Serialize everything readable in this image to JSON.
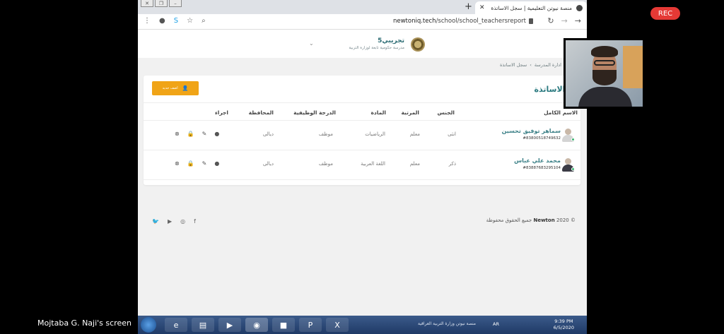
{
  "browser": {
    "tab_title": "منصة نيوتن التعليمية | سجل الاساتذة",
    "url_host": "newtoniq.tech",
    "url_path": "/school/school_teachersreport"
  },
  "site": {
    "school_name": "تجريبي5",
    "school_sub": "مدرسة حكومية تابعة لوزارة التربية"
  },
  "breadcrumb": {
    "parent": "ادارة المدرسة",
    "separator": "›",
    "current": "سجل الاساتذة"
  },
  "page": {
    "title": "جل الاساتذة",
    "add_button": "اضف جديد"
  },
  "table": {
    "headers": {
      "name": "الاسم الكامل",
      "gender": "الجنس",
      "rank": "المرتبة",
      "subject": "المادة",
      "grade": "الدرجة الوظيفية",
      "province": "المحافظة",
      "action": "اجراء"
    },
    "rows": [
      {
        "name": "سماهر توفيق تحسين",
        "id": "#8380051874963​2",
        "gender": "انثى",
        "rank": "معلم",
        "subject": "الرياضيات",
        "grade": "موظف",
        "province": "ديالى"
      },
      {
        "name": "محمد علي عباس",
        "id": "#838876832951​04",
        "gender": "ذكر",
        "rank": "معلم",
        "subject": "اللغة العربية",
        "grade": "موظف",
        "province": "ديالى"
      }
    ]
  },
  "footer": {
    "brand": "Newton",
    "copyright_prefix": "© ",
    "year": "2020",
    "rights": "جميع الحقوق محفوظة"
  },
  "taskbar": {
    "active_task": "منصة نيوتن وزارة التربية العراقية",
    "lang": "AR",
    "time": "9:39 PM",
    "date": "6/5/2020"
  },
  "overlay": {
    "rec_label": "REC",
    "screen_label": "Mojtaba G. Naji's screen"
  },
  "colors": {
    "accent": "#2b7a80",
    "button": "#f0a417",
    "online": "#3cb371"
  }
}
